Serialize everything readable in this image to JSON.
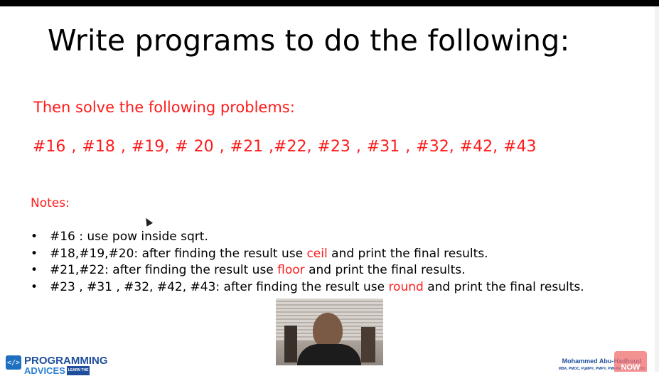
{
  "slide": {
    "title": "Write programs to do the following:",
    "subtitle": "Then solve the following problems:",
    "problems": "#16 , #18 , #19, # 20 , #21 ,#22, #23 , #31 , #32, #42, #43",
    "notes_label": "Notes:",
    "notes": [
      {
        "bullet": "•",
        "before": "#16 : use pow inside sqrt.",
        "keyword": "",
        "after": ""
      },
      {
        "bullet": "•",
        "before": "#18,#19,#20: after finding the result use ",
        "keyword": "ceil",
        "after": " and print the final results."
      },
      {
        "bullet": "•",
        "before": "#21,#22: after finding the result use ",
        "keyword": "floor",
        "after": " and print the final results."
      },
      {
        "bullet": "•",
        "before": "#23 , #31 , #32, #42, #43: after finding the result use ",
        "keyword": "round",
        "after": " and print the final results."
      }
    ]
  },
  "branding": {
    "logo_line1": "PROGRAMMING",
    "logo_line2": "ADVICES",
    "logo_tag": "LEARN THE",
    "logo_mark": "</>",
    "author_name": "Mohammed Abu-Hadhoud",
    "author_creds": "MBA, PMOC, PgMP®, PMP®, PMI-RMP®, C... MCSD",
    "badge": "NOW"
  },
  "colors": {
    "accent_red": "#ff1a1a",
    "brand_blue": "#1f4f9c"
  }
}
